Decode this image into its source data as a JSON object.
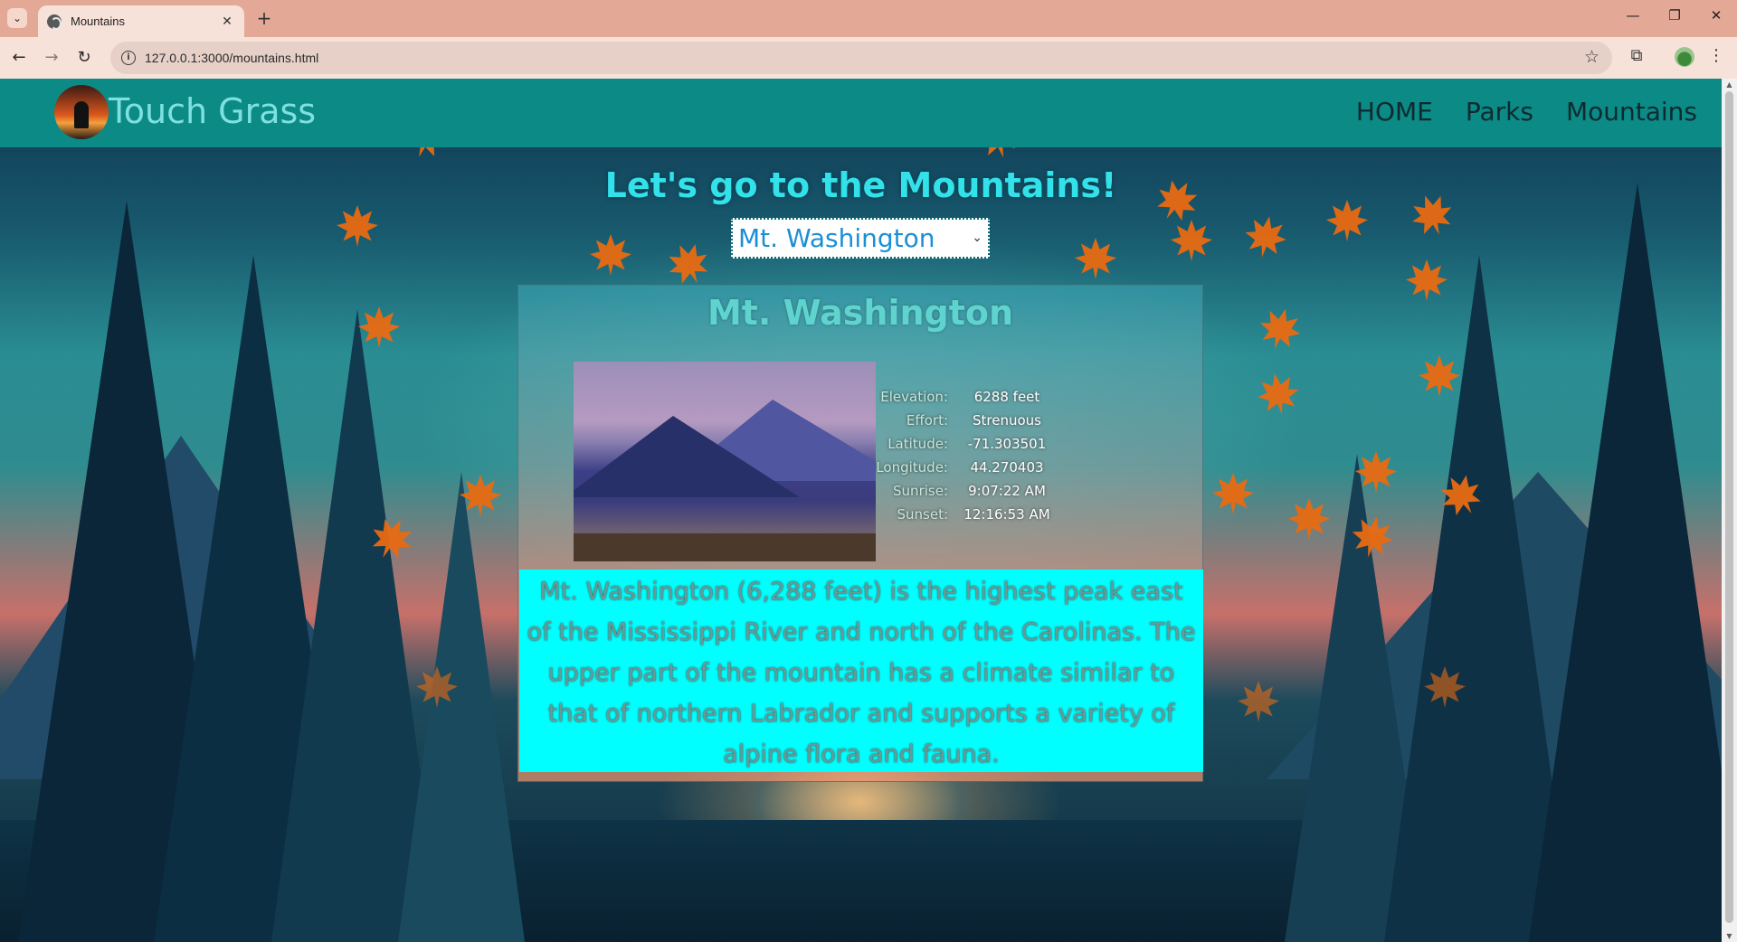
{
  "browser": {
    "tab_title": "Mountains",
    "url": "127.0.0.1:3000/mountains.html",
    "new_tab_label": "+",
    "tab_close_label": "✕"
  },
  "site": {
    "brand": "Touch Grass",
    "nav": [
      "HOME",
      "Parks",
      "Mountains"
    ]
  },
  "page": {
    "heading": "Let's go to the Mountains!",
    "select": {
      "selected": "Mt. Washington"
    }
  },
  "mountain": {
    "name": "Mt. Washington",
    "stats": [
      {
        "label": "Elevation:",
        "value": "6288 feet"
      },
      {
        "label": "Effort:",
        "value": "Strenuous"
      },
      {
        "label": "Latitude:",
        "value": "-71.303501"
      },
      {
        "label": "Longitude:",
        "value": "44.270403"
      },
      {
        "label": "Sunrise:",
        "value": "9:07:22 AM"
      },
      {
        "label": "Sunset:",
        "value": "12:16:53 AM"
      }
    ],
    "description": "Mt. Washington (6,288 feet) is the highest peak east of the Mississippi River and north of the Carolinas. The upper part of the mountain has a climate similar to that of northern Labrador and supports a variety of alpine flora and fauna."
  },
  "colors": {
    "header": "#0b8a86",
    "heading": "#33e1ea",
    "description_bg": "#00ffff",
    "leaf": "#e86a12"
  }
}
